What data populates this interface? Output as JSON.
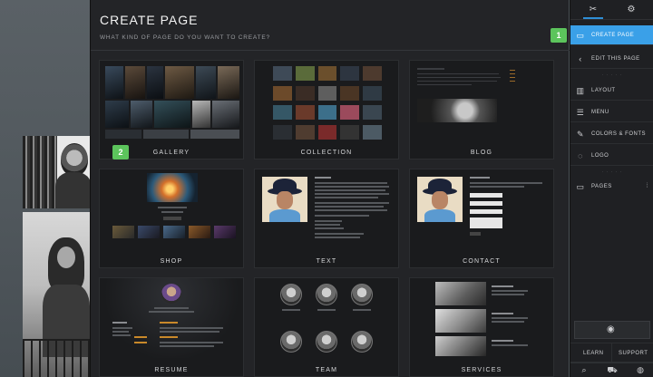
{
  "dialog": {
    "title": "CREATE PAGE",
    "subtitle": "WHAT KIND OF PAGE DO YOU WANT TO CREATE?"
  },
  "tiles": [
    {
      "label": "GALLERY"
    },
    {
      "label": "COLLECTION"
    },
    {
      "label": "BLOG"
    },
    {
      "label": "SHOP"
    },
    {
      "label": "TEXT"
    },
    {
      "label": "CONTACT"
    },
    {
      "label": "RESUME"
    },
    {
      "label": "TEAM"
    },
    {
      "label": "SERVICES"
    }
  ],
  "markers": {
    "one": "1",
    "two": "2"
  },
  "panel": {
    "create_page": "CREATE PAGE",
    "edit_page": "EDIT THIS PAGE",
    "layout": "LAYOUT",
    "menu": "MENU",
    "colors_fonts": "COLORS & FONTS",
    "logo": "LOGO",
    "pages": "PAGES",
    "learn": "LEARN",
    "support": "SUPPORT"
  },
  "icons": {
    "tools": "tools-icon",
    "settings": "gear-icon",
    "create": "create-page-icon",
    "back": "chevron-left-icon",
    "layout": "layout-icon",
    "menu": "menu-icon",
    "colors": "palette-icon",
    "logo": "logo-icon",
    "pages": "pages-icon",
    "preview": "eye-icon",
    "search": "search-icon",
    "cart": "cart-icon",
    "globe": "globe-icon"
  },
  "colors": {
    "accent": "#3aa0e8",
    "marker": "#5cc45c",
    "dialog_bg": "#232427"
  }
}
